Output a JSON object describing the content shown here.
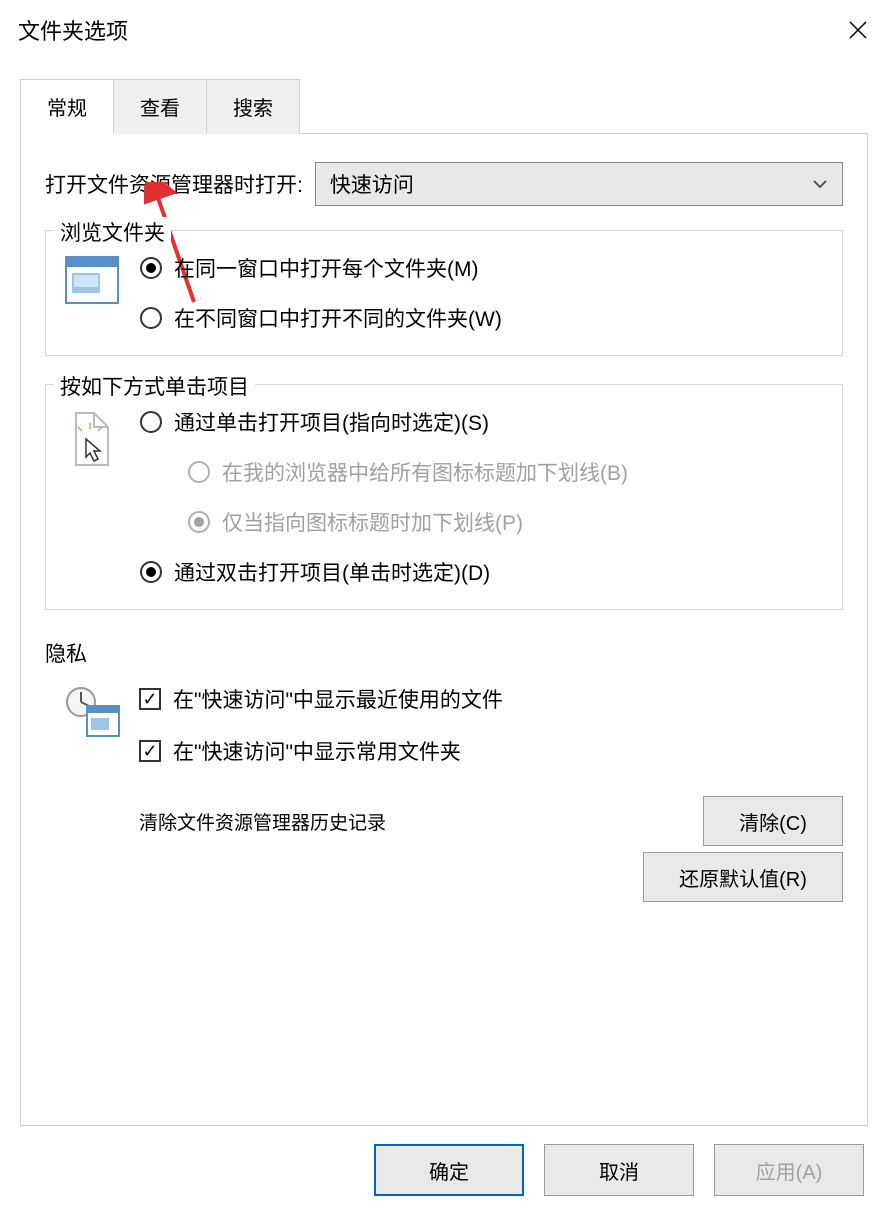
{
  "window": {
    "title": "文件夹选项"
  },
  "tabs": {
    "general": "常规",
    "view": "查看",
    "search": "搜索"
  },
  "open": {
    "label": "打开文件资源管理器时打开:",
    "value": "快速访问"
  },
  "browse": {
    "legend": "浏览文件夹",
    "same_window": "在同一窗口中打开每个文件夹(M)",
    "diff_window": "在不同窗口中打开不同的文件夹(W)"
  },
  "click": {
    "legend": "按如下方式单击项目",
    "single": "通过单击打开项目(指向时选定)(S)",
    "underline_all": "在我的浏览器中给所有图标标题加下划线(B)",
    "underline_point": "仅当指向图标标题时加下划线(P)",
    "double": "通过双击打开项目(单击时选定)(D)"
  },
  "privacy": {
    "legend": "隐私",
    "recent_files": "在\"快速访问\"中显示最近使用的文件",
    "frequent_folders": "在\"快速访问\"中显示常用文件夹",
    "clear_label": "清除文件资源管理器历史记录",
    "clear_btn": "清除(C)"
  },
  "restore": "还原默认值(R)",
  "footer": {
    "ok": "确定",
    "cancel": "取消",
    "apply": "应用(A)"
  }
}
